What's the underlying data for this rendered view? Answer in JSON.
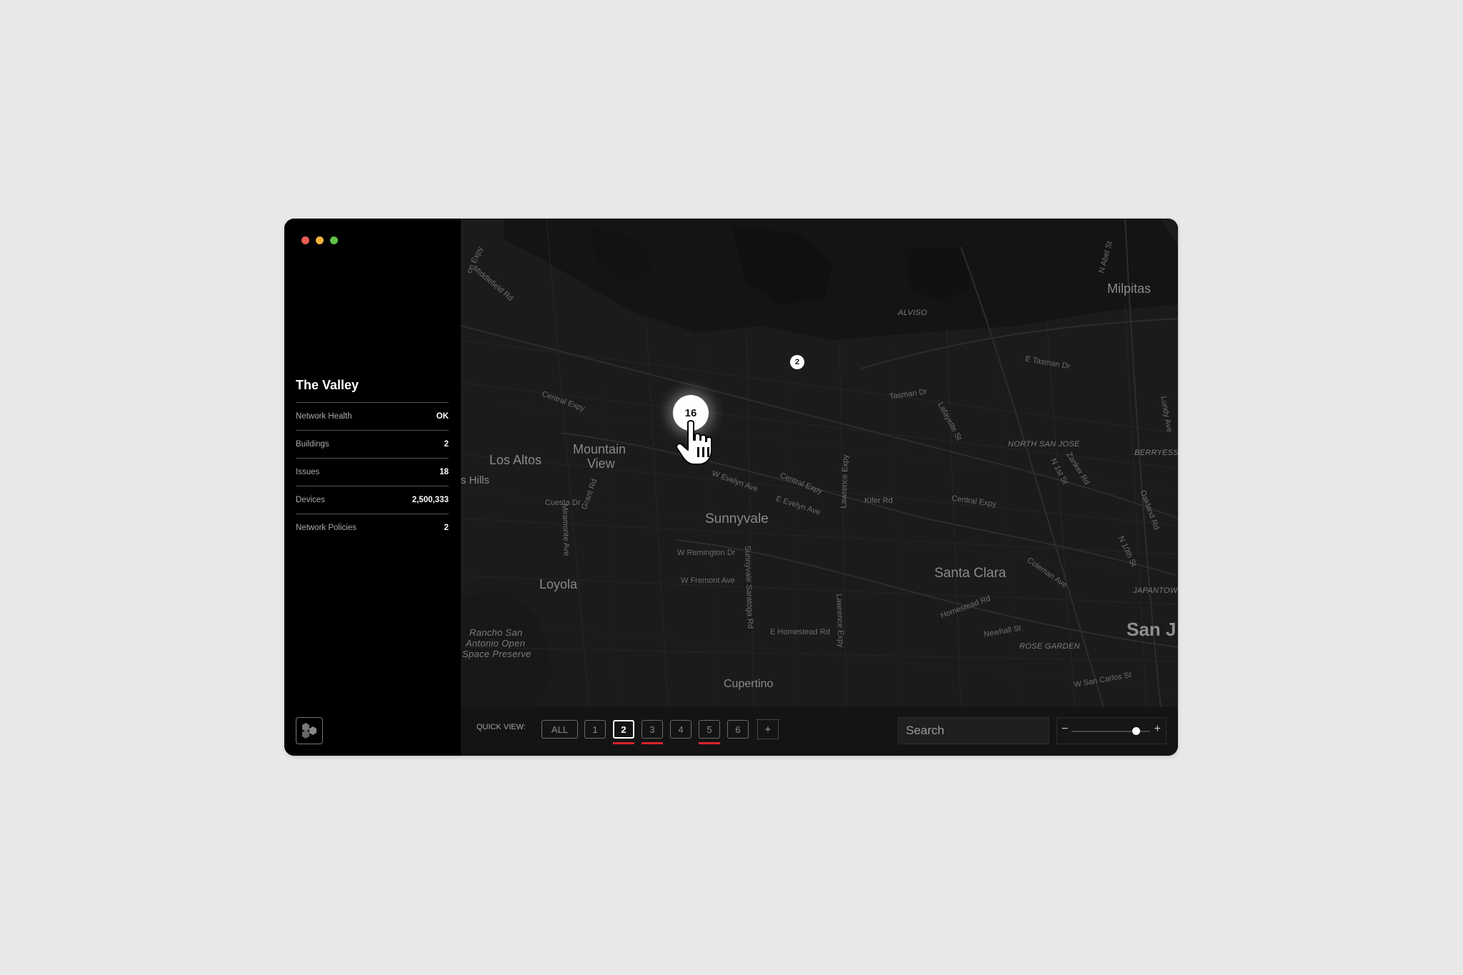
{
  "sidebar": {
    "title": "The Valley",
    "stats": [
      {
        "label": "Network Health",
        "value": "OK"
      },
      {
        "label": "Buildings",
        "value": "2"
      },
      {
        "label": "Issues",
        "value": "18"
      },
      {
        "label": "Devices",
        "value": "2,500,333"
      },
      {
        "label": "Network Policies",
        "value": "2"
      }
    ]
  },
  "map": {
    "cities": {
      "mountain_view_1": "Mountain",
      "mountain_view_2": "View",
      "los_altos": "Los Altos",
      "sunnyvale": "Sunnyvale",
      "santa_clara": "Santa Clara",
      "loyola": "Loyola",
      "cupertino": "Cupertino",
      "milpitas": "Milpitas",
      "san_jose": "San J",
      "hills": "s Hills"
    },
    "neighborhoods": {
      "alviso": "ALVISO",
      "north_san_jose": "NORTH SAN JOSE",
      "berryessa": "BERRYESS",
      "japantown": "JAPANTOWN",
      "rose_garden": "ROSE GARDEN",
      "rancho_1": "Rancho San",
      "rancho_2": "Antonio Open",
      "rancho_3": "Space Preserve"
    },
    "roads": {
      "central_expy_1": "Central Expy",
      "central_expy_2": "Central Expy",
      "central_expy_3": "Central Expy",
      "middlefield": "Middlefield Rd",
      "expy_top": "on Expy",
      "tasman": "Tasman Dr",
      "e_tasman": "E Tasman Dr",
      "lafayette": "Lafayette St",
      "w_evelyn": "W Evelyn Ave",
      "e_evelyn": "E Evelyn Ave",
      "lawrence_1": "Lawrence Expy",
      "lawrence_2": "Lawrence Expy",
      "kifer": "Kifer Rd",
      "cuesta": "Cuesta Dr",
      "miramonte": "Miramonte Ave",
      "grant": "Grant Rd",
      "w_remington": "W Remington Dr",
      "w_fremont": "W Fremont Ave",
      "sunnyvale_saratoga": "Sunnyvale Saratoga Rd",
      "e_homestead": "E Homestead Rd",
      "homestead": "Homestead Rd",
      "coleman": "Coleman Ave",
      "newhall": "Newhall St",
      "w_san_carlos": "W San Carlos St",
      "n_1st": "N 1st St",
      "zanker": "Zanker Rd",
      "oakland": "Oakland Rd",
      "n_10th": "N 10th St",
      "lundy": "Lundy Ave",
      "n_abel": "N Abel St"
    },
    "clusters": [
      {
        "count": "16"
      },
      {
        "count": "2"
      }
    ]
  },
  "toolbar": {
    "quick_view_label": "QUICK VIEW:",
    "quick_views": [
      {
        "label": "ALL",
        "active": false,
        "alert": false
      },
      {
        "label": "1",
        "active": false,
        "alert": false
      },
      {
        "label": "2",
        "active": true,
        "alert": true
      },
      {
        "label": "3",
        "active": false,
        "alert": true
      },
      {
        "label": "4",
        "active": false,
        "alert": false
      },
      {
        "label": "5",
        "active": false,
        "alert": true
      },
      {
        "label": "6",
        "active": false,
        "alert": false
      }
    ],
    "add_label": "+",
    "search_placeholder": "Search",
    "zoom_minus": "−",
    "zoom_plus": "+",
    "zoom_level": 0.82,
    "alert_color": "#d9222a"
  }
}
